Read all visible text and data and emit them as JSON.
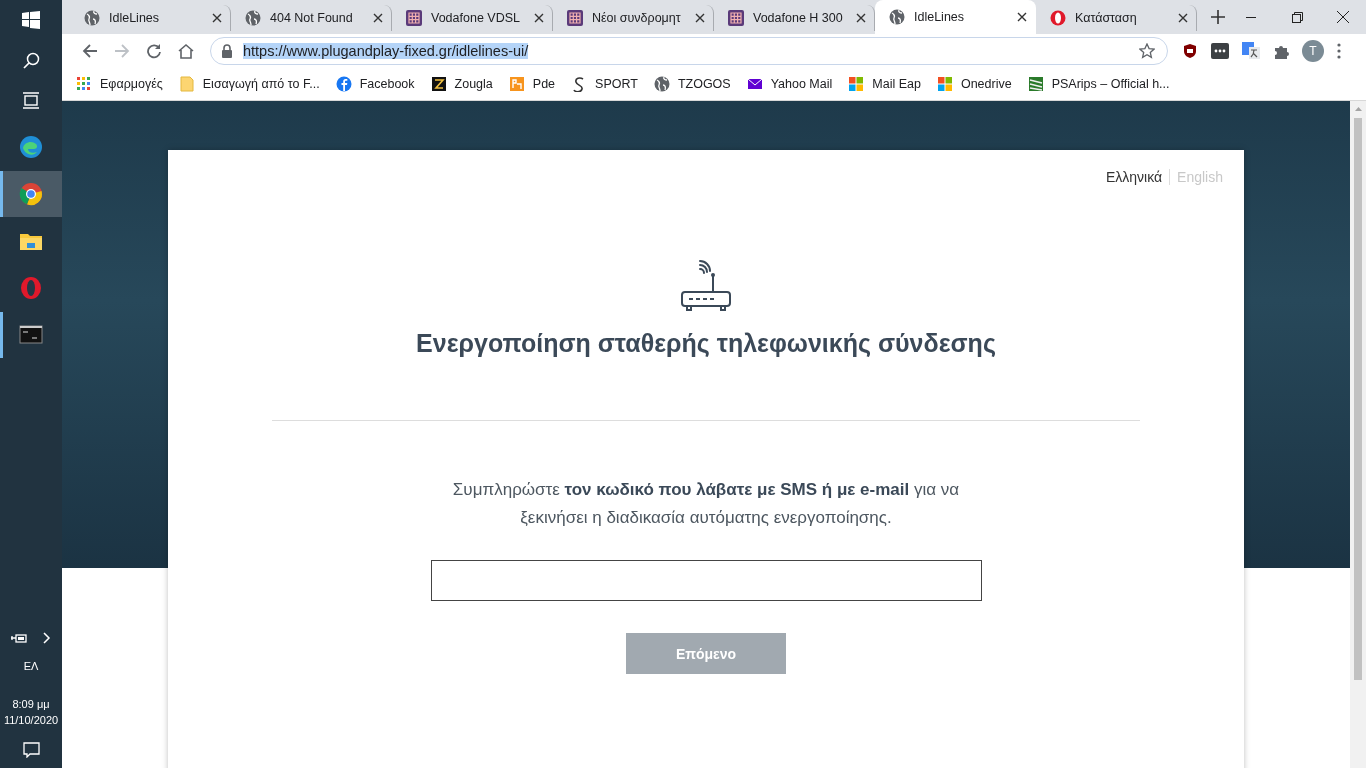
{
  "taskbar": {
    "apps": [
      {
        "kind": "edge",
        "selected": false,
        "running": false
      },
      {
        "kind": "chrome",
        "selected": true,
        "running": true
      },
      {
        "kind": "explorer",
        "selected": false,
        "running": false
      },
      {
        "kind": "opera",
        "selected": false,
        "running": false
      },
      {
        "kind": "terminal",
        "selected": false,
        "running": true
      }
    ],
    "language": "ΕΛ",
    "time": "8:09 μμ",
    "date": "11/10/2020"
  },
  "tabs": [
    {
      "title": "IdleLines",
      "kind": "globe",
      "selected": false
    },
    {
      "title": "404 Not Found",
      "kind": "globe",
      "selected": false
    },
    {
      "title": "Vodafone VDSL",
      "kind": "grid",
      "selected": false
    },
    {
      "title": "Νέοι συνδρομητ",
      "kind": "grid",
      "selected": false
    },
    {
      "title": "Vodafone H 300",
      "kind": "grid",
      "selected": false
    },
    {
      "title": "IdleLines",
      "kind": "globe",
      "selected": true
    },
    {
      "title": "Κατάσταση",
      "kind": "opera",
      "selected": false
    }
  ],
  "toolbar": {
    "url": "https://www.plugandplay-fixed.gr/idlelines-ui/",
    "profile_initial": "T"
  },
  "bookmarks": [
    {
      "label": "Εφαρμογές",
      "kind": "apps"
    },
    {
      "label": "Εισαγωγή από το F...",
      "kind": "folder"
    },
    {
      "label": "Facebook",
      "kind": "facebook"
    },
    {
      "label": "Zougla",
      "kind": "letter"
    },
    {
      "label": "Pde",
      "kind": "square"
    },
    {
      "label": "SPORT",
      "kind": "curve"
    },
    {
      "label": "TZOGOS",
      "kind": "globe"
    },
    {
      "label": "Yahoo Mail",
      "kind": "mail"
    },
    {
      "label": "Mail Eap",
      "kind": "windows"
    },
    {
      "label": "Onedrive",
      "kind": "windows"
    },
    {
      "label": "PSArips – Official h...",
      "kind": "stripes"
    }
  ],
  "page": {
    "languages": [
      {
        "label": "Ελληνικά",
        "selected": true
      },
      {
        "label": "English",
        "selected": false
      }
    ],
    "title": "Ενεργοποίηση σταθερής τηλεφωνικής σύνδεσης",
    "instructions": "Συμπληρώστε **τον κωδικό που λάβατε με SMS ή με e-mail** για να ξεκινήσει η διαδικασία αυτόματης ενεργοποίησης.",
    "button": {
      "label": "Επόμενο",
      "disabled": true
    }
  }
}
